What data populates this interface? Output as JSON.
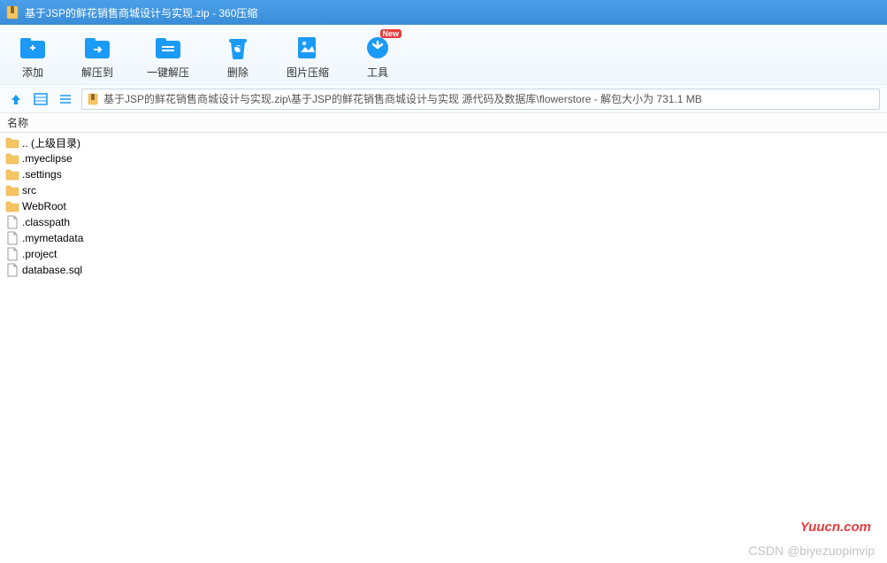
{
  "title": "基于JSP的鲜花销售商城设计与实现.zip - 360压缩",
  "toolbar": [
    {
      "label": "添加",
      "icon": "add-folder-icon"
    },
    {
      "label": "解压到",
      "icon": "extract-to-icon"
    },
    {
      "label": "一键解压",
      "icon": "extract-icon"
    },
    {
      "label": "删除",
      "icon": "delete-icon"
    },
    {
      "label": "图片压缩",
      "icon": "image-compress-icon"
    },
    {
      "label": "工具",
      "icon": "tools-icon",
      "badge": "New"
    }
  ],
  "path": "基于JSP的鲜花销售商城设计与实现.zip\\基于JSP的鲜花销售商城设计与实现 源代码及数据库\\flowerstore - 解包大小为 731.1 MB",
  "columns": {
    "name": "名称"
  },
  "files": [
    {
      "name": ".. (上级目录)",
      "type": "folder"
    },
    {
      "name": ".myeclipse",
      "type": "folder"
    },
    {
      "name": ".settings",
      "type": "folder"
    },
    {
      "name": "src",
      "type": "folder"
    },
    {
      "name": "WebRoot",
      "type": "folder"
    },
    {
      "name": ".classpath",
      "type": "file"
    },
    {
      "name": ".mymetadata",
      "type": "file"
    },
    {
      "name": ".project",
      "type": "file"
    },
    {
      "name": "database.sql",
      "type": "file"
    }
  ],
  "watermark1": "Yuucn.com",
  "watermark2": "CSDN @biyezuopinvip"
}
